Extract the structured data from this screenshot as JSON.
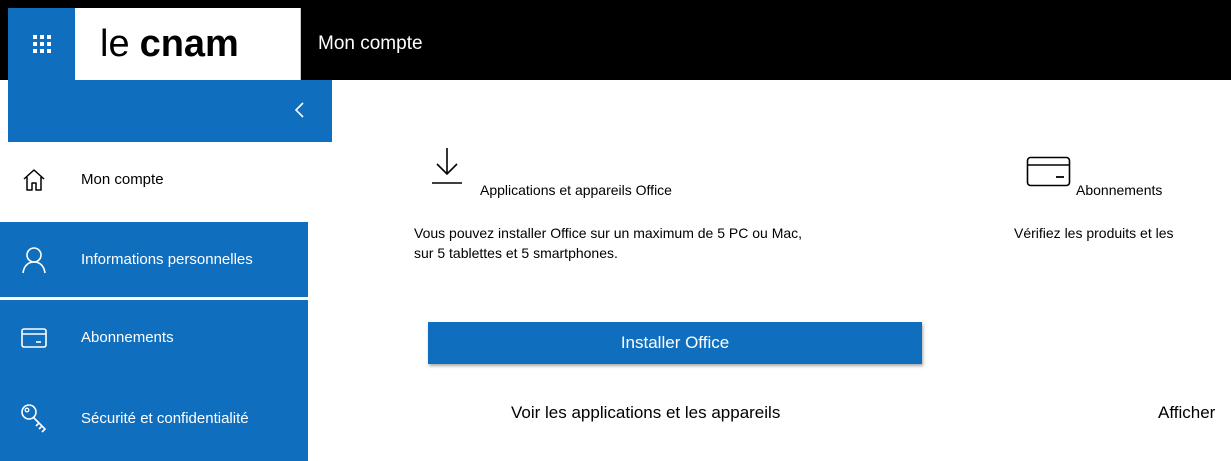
{
  "header": {
    "brand_le": "le",
    "brand_cnam": "cnam",
    "app_title": "Mon compte",
    "waffle_icon": "app-launcher-icon"
  },
  "sidebar": {
    "collapse_icon": "chevron-left-icon",
    "items": [
      {
        "label": "Mon compte",
        "icon": "home-icon",
        "active": true
      },
      {
        "label": "Informations personnelles",
        "icon": "person-icon",
        "active": false
      },
      {
        "label": "Abonnements",
        "icon": "card-icon",
        "active": false
      },
      {
        "label": "Sécurité et confidentialité",
        "icon": "key-icon",
        "active": false
      }
    ]
  },
  "main": {
    "apps_card": {
      "title": "Applications et appareils Office",
      "description_line1": "Vous pouvez installer Office sur un maximum de 5 PC ou Mac,",
      "description_line2": "sur 5 tablettes et 5 smartphones.",
      "install_button": "Installer Office",
      "view_link": "Voir les applications et les appareils"
    },
    "subs_card": {
      "title": "Abonnements",
      "description": "Vérifiez les produits et les",
      "view_link": "Afficher"
    }
  },
  "colors": {
    "accent": "#106ebe",
    "topbar": "#000000"
  }
}
